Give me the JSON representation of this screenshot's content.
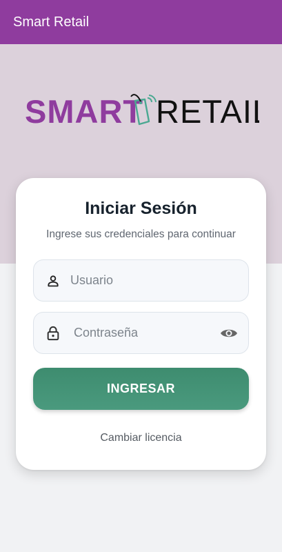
{
  "app_bar": {
    "title": "Smart Retail"
  },
  "logo": {
    "text_left": "SMART",
    "text_right": "RETAIL",
    "primary_color": "#8f3c9e",
    "secondary_color": "#111111",
    "accent_color": "#4aa891"
  },
  "login": {
    "title": "Iniciar Sesión",
    "subtitle": "Ingrese sus credenciales para continuar",
    "username_placeholder": "Usuario",
    "password_placeholder": "Contraseña",
    "submit_label": "INGRESAR",
    "license_link": "Cambiar licencia"
  },
  "icons": {
    "user": "person-icon",
    "password": "lock-icon",
    "toggle_visibility": "eye-icon"
  },
  "colors": {
    "app_bar": "#8f3c9e",
    "hero_bg": "#dcd1db",
    "button": "#449478",
    "page_bg": "#f1f2f4"
  }
}
